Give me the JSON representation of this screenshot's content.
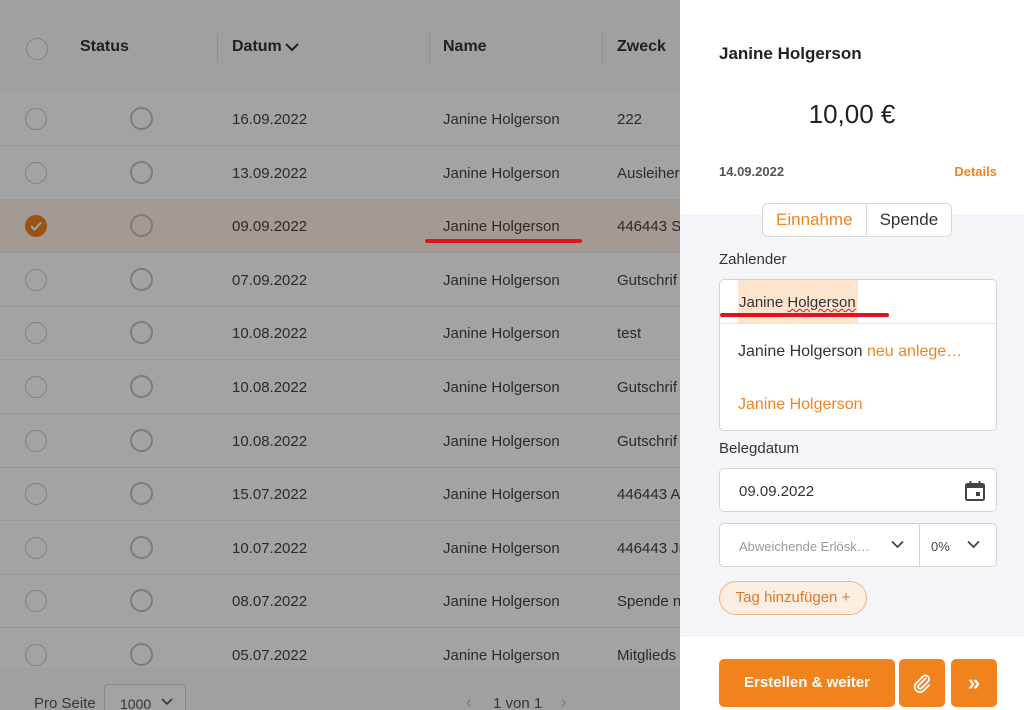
{
  "table": {
    "header": {
      "status": "Status",
      "date": "Datum",
      "name": "Name",
      "purpose": "Zweck"
    },
    "rows": [
      {
        "date": "16.09.2022",
        "name": "Janine Holgerson",
        "purpose": "222",
        "checked": false
      },
      {
        "date": "13.09.2022",
        "name": "Janine Holgerson",
        "purpose": "Ausleiher",
        "checked": false
      },
      {
        "date": "09.09.2022",
        "name": "Janine Holgerson",
        "purpose": "446443 S",
        "checked": true
      },
      {
        "date": "07.09.2022",
        "name": "Janine Holgerson",
        "purpose": "Gutschrif",
        "checked": false
      },
      {
        "date": "10.08.2022",
        "name": "Janine Holgerson",
        "purpose": "test",
        "checked": false
      },
      {
        "date": "10.08.2022",
        "name": "Janine Holgerson",
        "purpose": "Gutschrif",
        "checked": false
      },
      {
        "date": "10.08.2022",
        "name": "Janine Holgerson",
        "purpose": "Gutschrif",
        "checked": false
      },
      {
        "date": "15.07.2022",
        "name": "Janine Holgerson",
        "purpose": "446443 A",
        "checked": false
      },
      {
        "date": "10.07.2022",
        "name": "Janine Holgerson",
        "purpose": "446443 Ju",
        "checked": false
      },
      {
        "date": "08.07.2022",
        "name": "Janine Holgerson",
        "purpose": "Spende n",
        "checked": false
      },
      {
        "date": "05.07.2022",
        "name": "Janine Holgerson",
        "purpose": "Mitglieds",
        "checked": false
      }
    ],
    "footer": {
      "per_page_label": "Pro Seite",
      "per_page_value": "1000",
      "pagination": "1 von 1"
    }
  },
  "panel": {
    "title": "Janine Holgerson",
    "amount": "10,00 €",
    "date": "14.09.2022",
    "details_link": "Details",
    "type_tabs": [
      "Einnahme",
      "Spende"
    ],
    "active_tab": "Einnahme",
    "payer_label": "Zahlender",
    "payer_value_first": "Janine",
    "payer_value_last": "Holgerson",
    "payer_options": {
      "create_name": "Janine Holgerson",
      "create_action": "neu anlege…",
      "existing": "Janine Holgerson"
    },
    "document_date_label": "Belegdatum",
    "document_date_value": "09.09.2022",
    "revenue_account_placeholder": "Abweichende Erlösk…",
    "vat_value": "0%",
    "add_tag_label": "Tag hinzufügen +",
    "create_next_label": "Erstellen & weiter",
    "skip_glyph": "»"
  },
  "colors": {
    "accent": "#f0831e",
    "annotation_red": "#e0141e"
  }
}
